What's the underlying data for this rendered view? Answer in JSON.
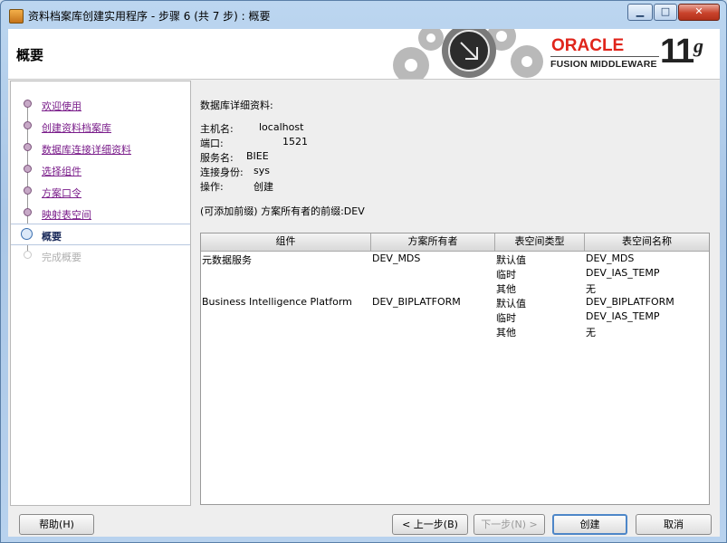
{
  "window": {
    "title": "资料档案库创建实用程序 - 步骤 6 (共 7 步) : 概要",
    "controls": {
      "minimize": "▁",
      "maximize": "□",
      "close": "✕"
    }
  },
  "header": {
    "title": "概要",
    "brand": {
      "oracle": "ORACLE",
      "product": "FUSION MIDDLEWARE",
      "version_number": "11",
      "version_letter": "g"
    }
  },
  "nav": {
    "steps": [
      {
        "label": "欢迎使用",
        "state": "done"
      },
      {
        "label": "创建资料档案库",
        "state": "done"
      },
      {
        "label": "数据库连接详细资料",
        "state": "done"
      },
      {
        "label": "选择组件",
        "state": "done"
      },
      {
        "label": "方案口令",
        "state": "done"
      },
      {
        "label": "映射表空间",
        "state": "done"
      },
      {
        "label": "概要",
        "state": "current"
      },
      {
        "label": "完成概要",
        "state": "todo"
      }
    ]
  },
  "main": {
    "section_title": "数据库详细资料:",
    "details": [
      {
        "key": "主机名:",
        "value": "localhost"
      },
      {
        "key": "端口:",
        "value": "1521"
      },
      {
        "key": "服务名:",
        "value": "BIEE"
      },
      {
        "key": "连接身份:",
        "value": "sys"
      },
      {
        "key": "操作:",
        "value": "创建"
      }
    ],
    "prefix_note": "(可添加前缀) 方案所有者的前缀:DEV",
    "table": {
      "columns": [
        "组件",
        "方案所有者",
        "表空间类型",
        "表空间名称"
      ],
      "rows": [
        {
          "component": "元数据服务",
          "owner": "DEV_MDS",
          "type": "默认值",
          "name": "DEV_MDS"
        },
        {
          "component": "",
          "owner": "",
          "type": "临时",
          "name": "DEV_IAS_TEMP"
        },
        {
          "component": "",
          "owner": "",
          "type": "其他",
          "name": "无"
        },
        {
          "component": "Business Intelligence Platform",
          "owner": "DEV_BIPLATFORM",
          "type": "默认值",
          "name": "DEV_BIPLATFORM"
        },
        {
          "component": "",
          "owner": "",
          "type": "临时",
          "name": "DEV_IAS_TEMP"
        },
        {
          "component": "",
          "owner": "",
          "type": "其他",
          "name": "无"
        }
      ]
    }
  },
  "footer": {
    "help": "帮助(H)",
    "back": "< 上一步(B)",
    "next": "下一步(N) >",
    "create": "创建",
    "cancel": "取消"
  }
}
